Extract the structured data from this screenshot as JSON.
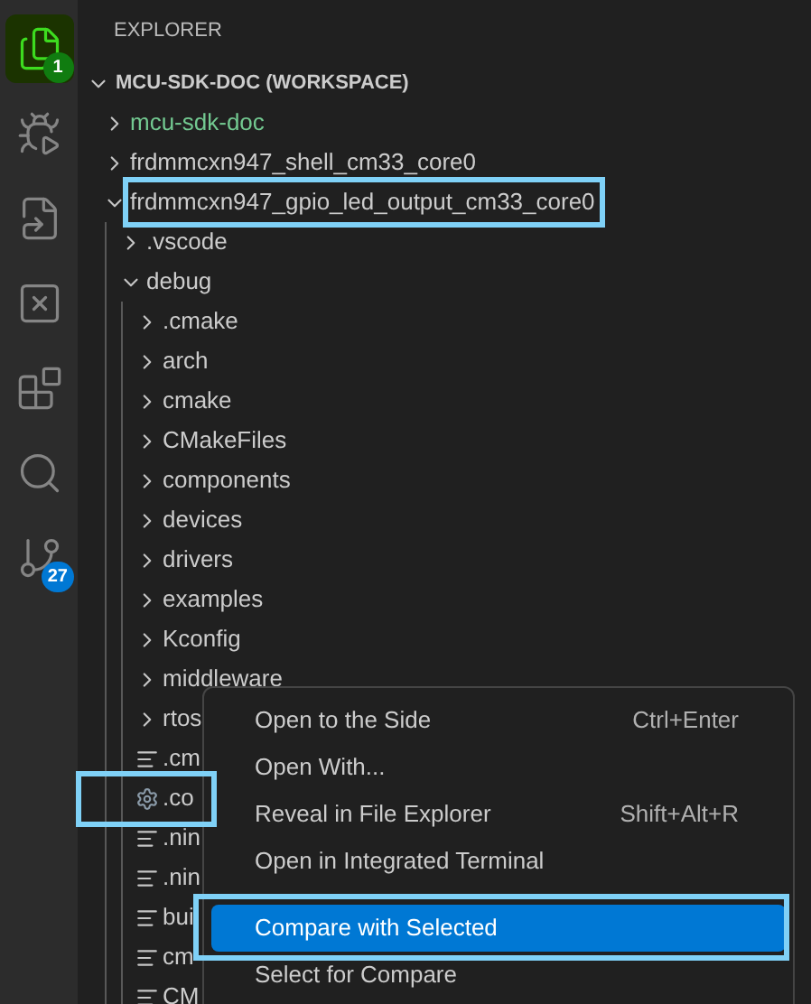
{
  "activity_bar": [
    {
      "kind": "explorer",
      "selected": true,
      "badge": "1"
    },
    {
      "kind": "run-debug",
      "selected": false
    },
    {
      "kind": "remote",
      "selected": false
    },
    {
      "kind": "x-box",
      "selected": false
    },
    {
      "kind": "extensions",
      "selected": false
    },
    {
      "kind": "search",
      "selected": false
    },
    {
      "kind": "source-control",
      "selected": false,
      "badge": "27"
    }
  ],
  "sidebar": {
    "title": "EXPLORER",
    "workspace": {
      "label": "MCU-SDK-DOC (WORKSPACE)",
      "expanded": true,
      "children": [
        {
          "kind": "folder",
          "label": "mcu-sdk-doc",
          "expanded": false,
          "color": "#73c991",
          "highlighted": false
        },
        {
          "kind": "folder",
          "label": "frdmmcxn947_shell_cm33_core0",
          "expanded": false,
          "highlighted": false
        },
        {
          "kind": "folder",
          "label": "frdmmcxn947_gpio_led_output_cm33_core0",
          "expanded": true,
          "highlighted": true,
          "children": [
            {
              "kind": "folder",
              "label": ".vscode",
              "expanded": false,
              "highlighted": false
            },
            {
              "kind": "folder",
              "label": "debug",
              "expanded": true,
              "highlighted": false,
              "children": [
                {
                  "kind": "folder",
                  "label": ".cmake",
                  "expanded": false,
                  "highlighted": false
                },
                {
                  "kind": "folder",
                  "label": "arch",
                  "expanded": false,
                  "highlighted": false
                },
                {
                  "kind": "folder",
                  "label": "cmake",
                  "expanded": false,
                  "highlighted": false
                },
                {
                  "kind": "folder",
                  "label": "CMakeFiles",
                  "expanded": false,
                  "highlighted": false
                },
                {
                  "kind": "folder",
                  "label": "components",
                  "expanded": false,
                  "highlighted": false
                },
                {
                  "kind": "folder",
                  "label": "devices",
                  "expanded": false,
                  "highlighted": false
                },
                {
                  "kind": "folder",
                  "label": "drivers",
                  "expanded": false,
                  "highlighted": false
                },
                {
                  "kind": "folder",
                  "label": "examples",
                  "expanded": false,
                  "highlighted": false
                },
                {
                  "kind": "folder",
                  "label": "Kconfig",
                  "expanded": false,
                  "highlighted": false
                },
                {
                  "kind": "folder",
                  "label": "middleware",
                  "expanded": false,
                  "highlighted": false
                },
                {
                  "kind": "folder",
                  "label": "rtos",
                  "expanded": false,
                  "highlighted": false
                },
                {
                  "kind": "text-file",
                  "label": ".cm",
                  "highlighted": false
                },
                {
                  "kind": "settings-file",
                  "label": ".co",
                  "highlighted": true
                },
                {
                  "kind": "text-file",
                  "label": ".nin",
                  "highlighted": false
                },
                {
                  "kind": "text-file",
                  "label": ".nin",
                  "highlighted": false
                },
                {
                  "kind": "text-file",
                  "label": "bui",
                  "highlighted": false
                },
                {
                  "kind": "text-file",
                  "label": "cm",
                  "highlighted": false
                },
                {
                  "kind": "text-file",
                  "label": "CM",
                  "highlighted": false
                }
              ]
            }
          ]
        }
      ]
    }
  },
  "context_menu": [
    {
      "kind": "item",
      "label": "Open to the Side",
      "shortcut": "Ctrl+Enter",
      "selected": false,
      "highlighted": false
    },
    {
      "kind": "item",
      "label": "Open With...",
      "selected": false,
      "highlighted": false
    },
    {
      "kind": "item",
      "label": "Reveal in File Explorer",
      "shortcut": "Shift+Alt+R",
      "selected": false,
      "highlighted": false
    },
    {
      "kind": "item",
      "label": "Open in Integrated Terminal",
      "selected": false,
      "highlighted": false
    },
    {
      "kind": "separator"
    },
    {
      "kind": "item",
      "label": "Compare with Selected",
      "selected": true,
      "highlighted": true
    },
    {
      "kind": "item",
      "label": "Select for Compare",
      "selected": false,
      "highlighted": false
    }
  ]
}
